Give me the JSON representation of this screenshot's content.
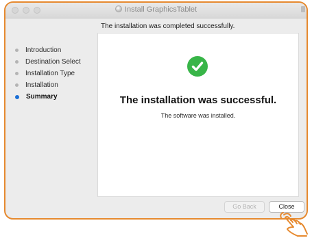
{
  "window": {
    "title": "Install GraphicsTablet"
  },
  "heading": "The installation was completed successfully.",
  "sidebar": {
    "steps": [
      {
        "label": "Introduction",
        "active": false
      },
      {
        "label": "Destination Select",
        "active": false
      },
      {
        "label": "Installation Type",
        "active": false
      },
      {
        "label": "Installation",
        "active": false
      },
      {
        "label": "Summary",
        "active": true
      }
    ]
  },
  "content": {
    "title": "The installation was successful.",
    "subtitle": "The software was installed."
  },
  "buttons": {
    "back_label": "Go Back",
    "close_label": "Close"
  },
  "colors": {
    "highlight_border": "#e6892e",
    "success_green": "#38b548",
    "active_step_dot": "#1a6fd6"
  },
  "icons": {
    "title": "disk-icon",
    "success": "checkmark-icon",
    "pointer": "hand-pointer-icon"
  }
}
